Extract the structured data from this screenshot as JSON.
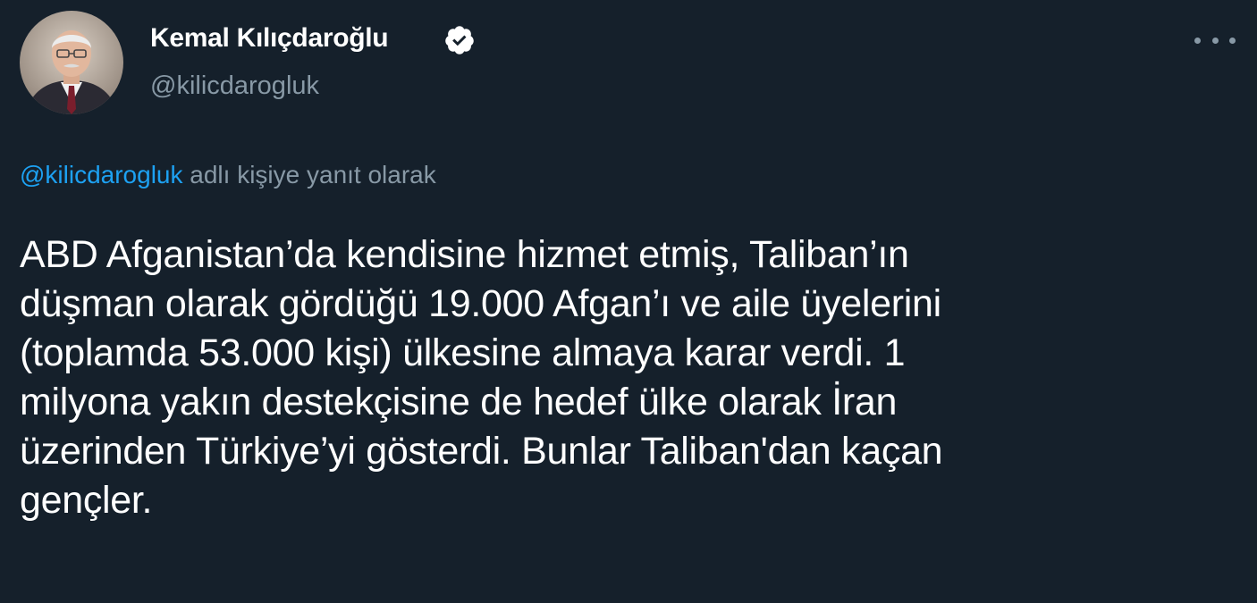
{
  "author": {
    "display_name": "Kemal Kılıçdaroğlu",
    "handle": "@kilicdarogluk",
    "verified": true
  },
  "reply_context": {
    "mention": "@kilicdarogluk",
    "suffix": "adlı kişiye yanıt olarak"
  },
  "tweet": {
    "lines": [
      "ABD Afganistan’da kendisine hizmet etmiş, Taliban’ın",
      "düşman olarak gördüğü 19.000 Afgan’ı ve aile üyelerini",
      "(toplamda 53.000 kişi) ülkesine almaya karar verdi. 1",
      "milyona yakın destekçisine de hedef ülke olarak İran",
      "üzerinden Türkiye’yi gösterdi. Bunlar Taliban'dan kaçan",
      "gençler."
    ]
  },
  "icons": {
    "verified": "verified-badge-icon",
    "more": "more-options-icon"
  },
  "colors": {
    "background": "#15202b",
    "text": "#ffffff",
    "secondary": "#8899a6",
    "accent": "#1da1f2"
  }
}
